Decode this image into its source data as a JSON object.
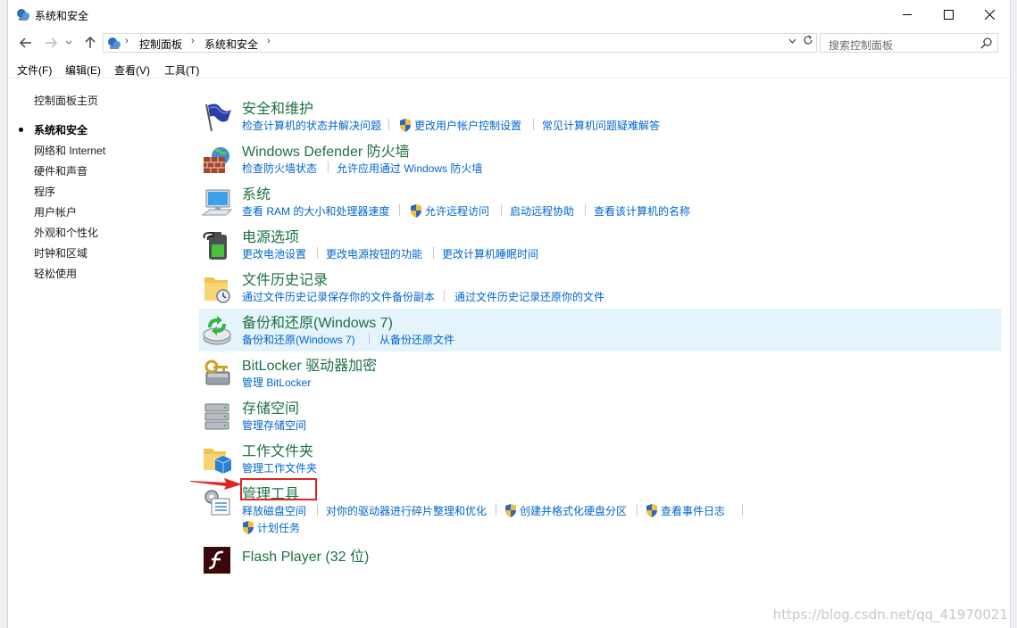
{
  "window": {
    "title": "系统和安全"
  },
  "nav": {
    "breadcrumbs": [
      "控制面板",
      "系统和安全"
    ],
    "search_placeholder": "搜索控制面板"
  },
  "menu": [
    "文件(F)",
    "编辑(E)",
    "查看(V)",
    "工具(T)"
  ],
  "sidebar": {
    "home": "控制面板主页",
    "items": [
      {
        "label": "系统和安全",
        "current": true
      },
      {
        "label": "网络和 Internet"
      },
      {
        "label": "硬件和声音"
      },
      {
        "label": "程序"
      },
      {
        "label": "用户帐户"
      },
      {
        "label": "外观和个性化"
      },
      {
        "label": "时钟和区域"
      },
      {
        "label": "轻松使用"
      }
    ]
  },
  "categories": [
    {
      "title": "安全和维护",
      "icon": "flag-icon",
      "links": [
        {
          "label": "检查计算机的状态并解决问题"
        },
        {
          "label": "更改用户帐户控制设置",
          "shield": true
        },
        {
          "label": "常见计算机问题疑难解答"
        }
      ]
    },
    {
      "title": "Windows Defender 防火墙",
      "icon": "firewall-icon",
      "links": [
        {
          "label": "检查防火墙状态"
        },
        {
          "label": "允许应用通过 Windows 防火墙"
        }
      ]
    },
    {
      "title": "系统",
      "icon": "computer-icon",
      "links": [
        {
          "label": "查看 RAM 的大小和处理器速度"
        },
        {
          "label": "允许远程访问",
          "shield": true
        },
        {
          "label": "启动远程协助"
        },
        {
          "label": "查看该计算机的名称"
        }
      ]
    },
    {
      "title": "电源选项",
      "icon": "battery-icon",
      "links": [
        {
          "label": "更改电池设置"
        },
        {
          "label": "更改电源按钮的功能"
        },
        {
          "label": "更改计算机睡眠时间"
        }
      ]
    },
    {
      "title": "文件历史记录",
      "icon": "file-history-icon",
      "links": [
        {
          "label": "通过文件历史记录保存你的文件备份副本"
        },
        {
          "label": "通过文件历史记录还原你的文件"
        }
      ]
    },
    {
      "title": "备份和还原(Windows 7)",
      "icon": "backup-icon",
      "highlighted": true,
      "links": [
        {
          "label": "备份和还原(Windows 7)"
        },
        {
          "label": "从备份还原文件"
        }
      ]
    },
    {
      "title": "BitLocker 驱动器加密",
      "icon": "bitlocker-icon",
      "links": [
        {
          "label": "管理 BitLocker"
        }
      ]
    },
    {
      "title": "存储空间",
      "icon": "storage-icon",
      "links": [
        {
          "label": "管理存储空间"
        }
      ]
    },
    {
      "title": "工作文件夹",
      "icon": "work-folders-icon",
      "links": [
        {
          "label": "管理工作文件夹"
        }
      ]
    },
    {
      "title": "管理工具",
      "icon": "admin-tools-icon",
      "links": [
        {
          "label": "释放磁盘空间"
        },
        {
          "label": "对你的驱动器进行碎片整理和优化"
        },
        {
          "label": "创建并格式化硬盘分区",
          "shield": true
        },
        {
          "label": "查看事件日志",
          "shield": true
        },
        {
          "label": "计划任务",
          "shield": true
        }
      ]
    },
    {
      "title": "Flash Player (32 位)",
      "icon": "flash-icon",
      "links": []
    }
  ],
  "watermark": "https://blog.csdn.net/qq_41970021",
  "colors": {
    "title_green": "#1e7145",
    "link_blue": "#0066cc",
    "highlight": "#e5f3fb",
    "annotation_red": "#e02424"
  }
}
